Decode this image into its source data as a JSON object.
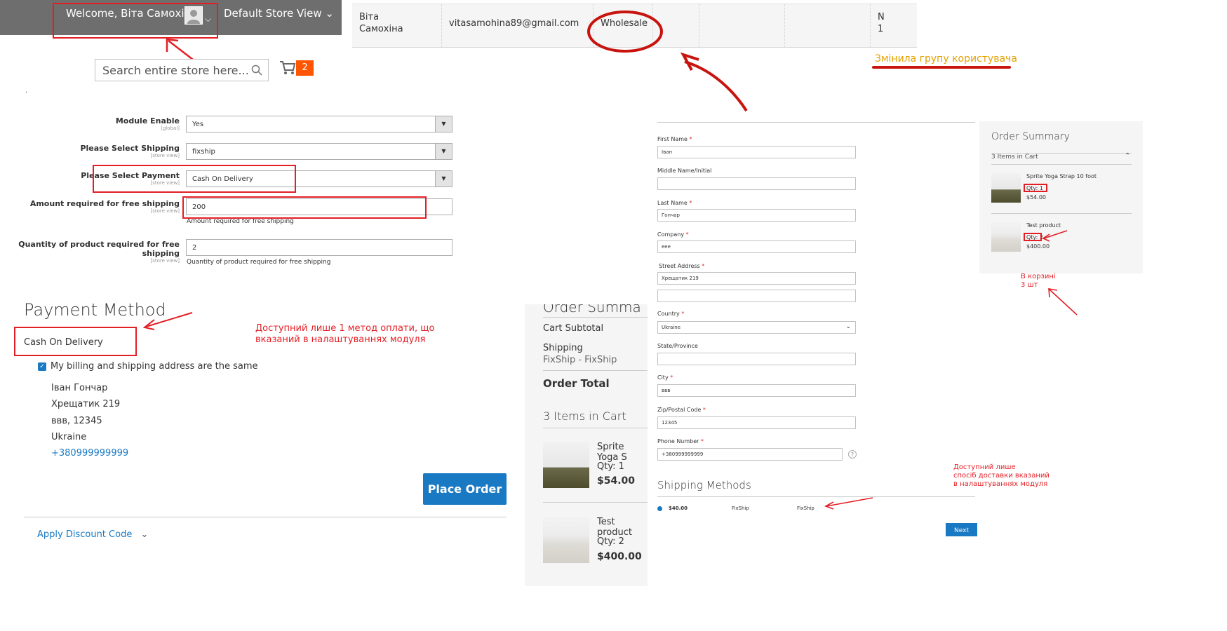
{
  "header": {
    "welcome": "Welcome, Віта Самохіна!",
    "store_view": "Default Store View",
    "search_placeholder": "Search entire store here...",
    "cart_count": "2"
  },
  "customer_grid": {
    "name": "Віта Самохіна",
    "email": "vitasamohina89@gmail.com",
    "group": "Wholesale",
    "truncated": "N\n1",
    "note": "Змінила групу користувача"
  },
  "config": {
    "rows": [
      {
        "label": "Module Enable",
        "scope": "[global]",
        "value": "Yes"
      },
      {
        "label": "Please Select Shipping",
        "scope": "[store view]",
        "value": "fixship"
      },
      {
        "label": "Please Select Payment",
        "scope": "[store view]",
        "value": "Cash On Delivery"
      },
      {
        "label": "Amount required for free shipping",
        "scope": "[store view]",
        "value": "200",
        "note": "Amount required for free shipping"
      },
      {
        "label": "Quantity of product required for free shipping",
        "scope": "[store view]",
        "value": "2",
        "note": "Quantity of product required for free shipping"
      }
    ]
  },
  "payment": {
    "title": "Payment Method",
    "option": "Cash On Delivery",
    "same_address": "My billing and shipping address are the same",
    "address": [
      "Іван Гончар",
      "Хрещатик 219",
      "ввв, 12345",
      "Ukraine"
    ],
    "phone": "+380999999999",
    "place_order": "Place Order",
    "discount": "Apply Discount Code",
    "note_line1": "Доступний лише 1 метод оплати, що",
    "note_line2": "вказаний в налаштуваннях модуля"
  },
  "order_summary_mid": {
    "title": "Order Summa",
    "cart_subtotal": "Cart Subtotal",
    "shipping": "Shipping",
    "shipping_method": "FixShip - FixShip",
    "order_total": "Order Total",
    "items_in_cart": "3 Items in Cart",
    "items": [
      {
        "name": "Sprite Yoga S",
        "qty": "Qty: 1",
        "price": "$54.00"
      },
      {
        "name": "Test product",
        "qty": "Qty: 2",
        "price": "$400.00"
      }
    ]
  },
  "shipping_form": {
    "fields": [
      {
        "label": "First Name",
        "required": true,
        "value": "Іван"
      },
      {
        "label": "Middle Name/Initial",
        "required": false,
        "value": ""
      },
      {
        "label": "Last Name",
        "required": true,
        "value": "Гончар"
      },
      {
        "label": "Company",
        "required": true,
        "value": "еее"
      },
      {
        "label": "Street Address",
        "required": true,
        "value": "Хрещатик 219"
      },
      {
        "label": "Country",
        "required": true,
        "value": "Ukraine"
      },
      {
        "label": "State/Province",
        "required": false,
        "value": ""
      },
      {
        "label": "City",
        "required": true,
        "value": "ввв"
      },
      {
        "label": "Zip/Postal Code",
        "required": true,
        "value": "12345"
      },
      {
        "label": "Phone Number",
        "required": true,
        "value": "+380999999999"
      }
    ],
    "req_mark": "*",
    "shipping_methods_title": "Shipping Methods",
    "method": {
      "price": "$40.00",
      "carrier": "FixShip",
      "title": "FixShip"
    },
    "next": "Next",
    "note_line1": "Доступний лише",
    "note_line2": "спосіб доставки вказаний",
    "note_line3": "в налаштуваннях модуля"
  },
  "order_summary_right": {
    "title": "Order Summary",
    "items_in_cart": "3 Items in Cart",
    "items": [
      {
        "name": "Sprite Yoga Strap 10 foot",
        "qty": "Qty: 1",
        "price": "$54.00"
      },
      {
        "name": "Test product",
        "qty": "Qty: 2",
        "price": "$400.00"
      }
    ],
    "note_line1": "В корзині",
    "note_line2": "3 шт"
  },
  "colors": {
    "accent": "#1979c3",
    "annotation": "#e31e24",
    "cart_badge": "#ff5501",
    "header_bg": "#6e6e6e"
  },
  "icons": [
    "user-avatar-icon",
    "chevron-down-icon",
    "search-icon",
    "cart-icon",
    "checkbox-checked-icon",
    "radio-selected-icon",
    "help-icon",
    "chevron-up-icon"
  ]
}
